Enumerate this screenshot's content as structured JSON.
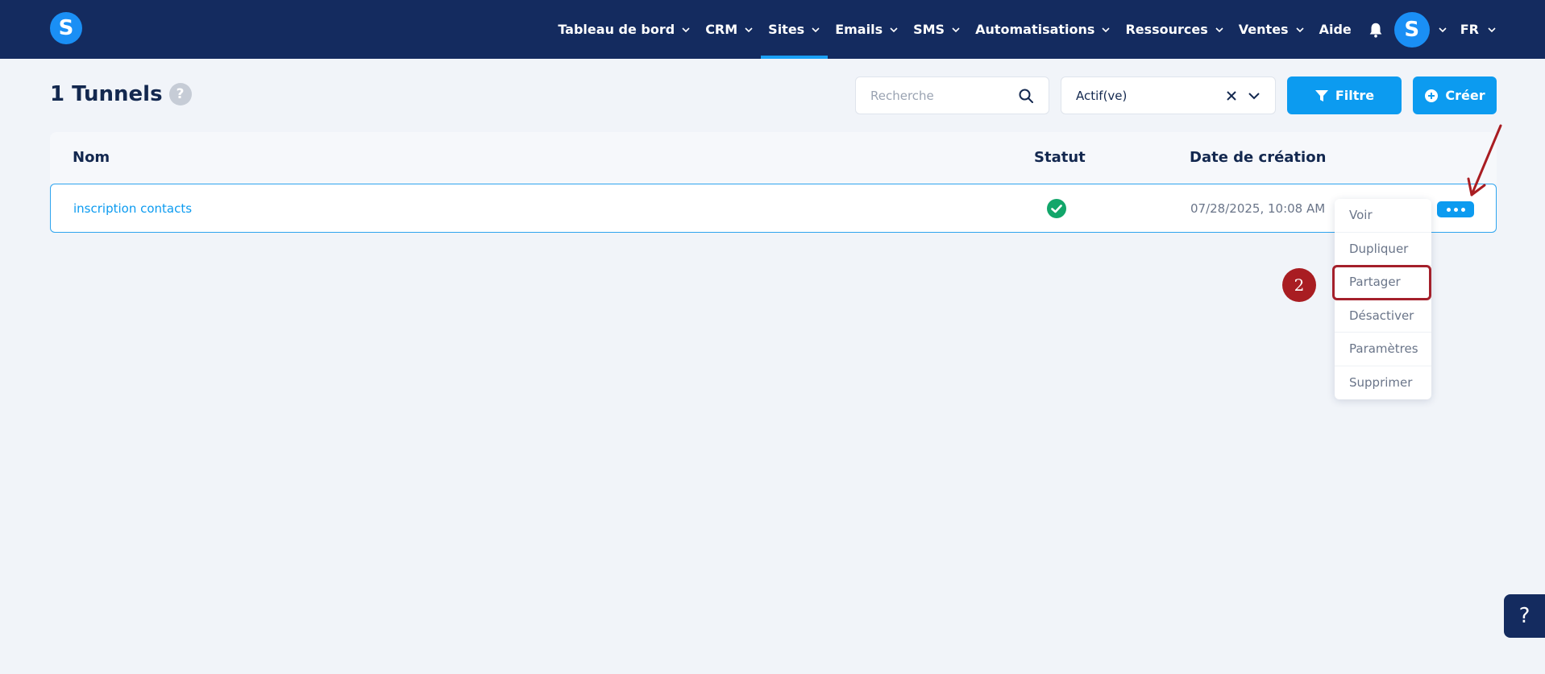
{
  "navbar": {
    "logo_letter": "S",
    "items": [
      {
        "label": "Tableau de bord",
        "has_menu": true
      },
      {
        "label": "CRM",
        "has_menu": true
      },
      {
        "label": "Sites",
        "has_menu": true,
        "active": true
      },
      {
        "label": "Emails",
        "has_menu": true
      },
      {
        "label": "SMS",
        "has_menu": true
      },
      {
        "label": "Automatisations",
        "has_menu": true
      },
      {
        "label": "Ressources",
        "has_menu": true
      },
      {
        "label": "Ventes",
        "has_menu": true
      },
      {
        "label": "Aide",
        "has_menu": false
      }
    ],
    "avatar_letter": "S",
    "language": "FR"
  },
  "page": {
    "title": "1 Tunnels",
    "help_icon_glyph": "?"
  },
  "toolbar": {
    "search_placeholder": "Recherche",
    "status_filter_value": "Actif(ve)",
    "filter_label": "Filtre",
    "create_label": "Créer"
  },
  "table": {
    "columns": {
      "name": "Nom",
      "status": "Statut",
      "date": "Date de création"
    },
    "rows": [
      {
        "name": "inscription contacts",
        "status": "active",
        "date": "07/28/2025, 10:08 AM"
      }
    ]
  },
  "row_menu": {
    "items": [
      "Voir",
      "Dupliquer",
      "Partager",
      "Désactiver",
      "Paramètres",
      "Supprimer"
    ],
    "highlighted": "Partager"
  },
  "annotation": {
    "step_number": "2"
  },
  "help_fab": {
    "glyph": "?"
  },
  "colors": {
    "navbar_bg": "#142b5f",
    "primary": "#0c9bf0",
    "annotation_red": "#a91d22",
    "status_green": "#12a66a"
  }
}
